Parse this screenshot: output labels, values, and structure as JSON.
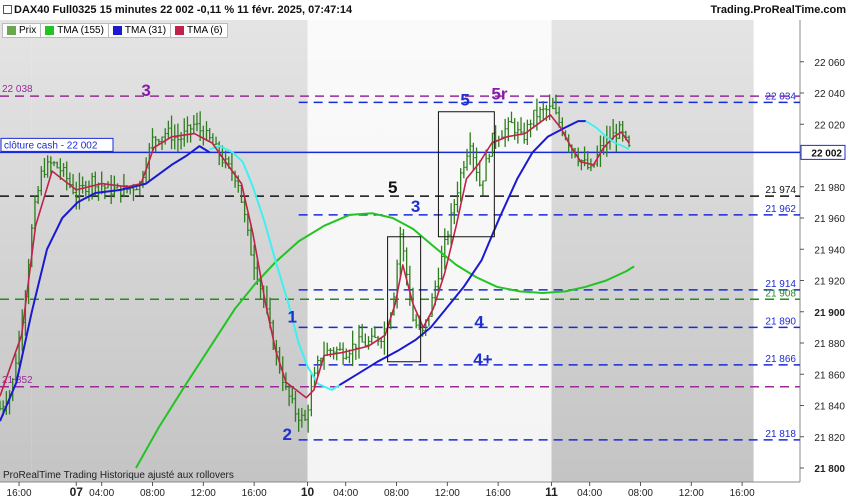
{
  "header": {
    "title": "DAX40 Full0325 15 minutes 22 002 -0,11 % 11 févr. 2025, 07:47:14",
    "brand": "Trading.ProRealTime.com"
  },
  "legend": [
    {
      "label": "Prix",
      "color": "#6aa84f"
    },
    {
      "label": "TMA (155)",
      "color": "#22c422"
    },
    {
      "label": "TMA (31)",
      "color": "#1a1acf"
    },
    {
      "label": "TMA (6)",
      "color": "#c0224a"
    }
  ],
  "footer": "ProRealTime Trading  Historique ajusté aux rollovers",
  "colors": {
    "bg_light": "#f4f4f4",
    "bg_dark": "#c4c4c4",
    "price": "#2e7d1e",
    "tma155": "#22c422",
    "tma31": "#1a1acf",
    "tma6": "#c0224a",
    "cyan": "#3ff0f0",
    "purple": "#9a2a9a",
    "blue_level": "#1a2ad8",
    "black_level": "#111111",
    "green_level": "#1f8f1f",
    "wave_blue": "#1f2fd0",
    "wave_purple": "#8a1aa8"
  },
  "chart_data": {
    "type": "line",
    "title": "DAX40 Full0325 15 minutes",
    "xlabel": "",
    "ylabel": "",
    "ylim": [
      21800,
      22060
    ],
    "y_ticks": [
      21800,
      21820,
      21840,
      21860,
      21880,
      21900,
      21920,
      21940,
      21960,
      21980,
      22000,
      22020,
      22040,
      22060
    ],
    "y_tick_labels": [
      "21 800",
      "21 820",
      "21 840",
      "21 860",
      "21 880",
      "21 900",
      "21 920",
      "21 940",
      "21 960",
      "21 980",
      "22 000",
      "22 020",
      "22 040",
      "22 060"
    ],
    "x_ticks": [
      {
        "label": "16:00",
        "t": 0.0
      },
      {
        "label": "07",
        "t": 4.5,
        "bold": true
      },
      {
        "label": "04:00",
        "t": 6.5
      },
      {
        "label": "08:00",
        "t": 10.5
      },
      {
        "label": "12:00",
        "t": 14.5
      },
      {
        "label": "16:00",
        "t": 18.5
      },
      {
        "label": "10",
        "t": 22.7,
        "bold": true
      },
      {
        "label": "04:00",
        "t": 25.7
      },
      {
        "label": "08:00",
        "t": 29.7
      },
      {
        "label": "12:00",
        "t": 33.7
      },
      {
        "label": "16:00",
        "t": 37.7
      },
      {
        "label": "11",
        "t": 41.9,
        "bold": true
      },
      {
        "label": "04:00",
        "t": 44.9
      },
      {
        "label": "08:00",
        "t": 48.9
      },
      {
        "label": "12:00",
        "t": 52.9
      },
      {
        "label": "16:00",
        "t": 56.9
      }
    ],
    "shading": [
      {
        "from": -1.5,
        "to": 0.95,
        "tone": "dark"
      },
      {
        "from": 0.95,
        "to": 22.7,
        "tone": "dark"
      },
      {
        "from": 22.7,
        "to": 41.9,
        "tone": "light"
      },
      {
        "from": 41.9,
        "to": 57.8,
        "tone": "dark"
      }
    ],
    "levels": [
      {
        "value": 22038,
        "color": "purple",
        "dash": "dash",
        "label": "22 038",
        "label_side": "left"
      },
      {
        "value": 22034,
        "color": "blue_level",
        "dash": "dash",
        "label": "22 034",
        "label_side": "right",
        "from_t": 22.0
      },
      {
        "value": 22002,
        "color": "blue_level",
        "dash": "solid",
        "label": "clôture cash -  22 002",
        "label_side": "left-box"
      },
      {
        "value": 21974,
        "color": "black_level",
        "dash": "dash",
        "label": "21 974",
        "label_side": "right"
      },
      {
        "value": 21962,
        "color": "blue_level",
        "dash": "dash",
        "label": "21 962",
        "label_side": "right",
        "from_t": 22.0
      },
      {
        "value": 21914,
        "color": "blue_level",
        "dash": "dash",
        "label": "21 914",
        "label_side": "right",
        "from_t": 22.0
      },
      {
        "value": 21908,
        "color": "green_level",
        "dash": "dash",
        "label": "21 908",
        "label_side": "right"
      },
      {
        "value": 21890,
        "color": "blue_level",
        "dash": "dash",
        "label": "21 890",
        "label_side": "right",
        "from_t": 22.0
      },
      {
        "value": 21866,
        "color": "blue_level",
        "dash": "dash",
        "label": "21 866",
        "label_side": "right",
        "from_t": 22.0
      },
      {
        "value": 21852,
        "color": "purple",
        "dash": "dash",
        "label": "21 852",
        "label_side": "left"
      },
      {
        "value": 21818,
        "color": "blue_level",
        "dash": "dash",
        "label": "21 818",
        "label_side": "right",
        "from_t": 22.0
      }
    ],
    "current_price": {
      "value": 22002,
      "label": "22 002"
    },
    "price_anchors": [
      [
        -1.5,
        21838
      ],
      [
        -0.6,
        21850
      ],
      [
        0.4,
        21905
      ],
      [
        1.1,
        21960
      ],
      [
        1.8,
        21990
      ],
      [
        2.6,
        21995
      ],
      [
        3.4,
        21990
      ],
      [
        4.5,
        21975
      ],
      [
        5.8,
        21985
      ],
      [
        7.0,
        21978
      ],
      [
        8.4,
        21978
      ],
      [
        9.5,
        21982
      ],
      [
        10.5,
        22010
      ],
      [
        11.6,
        22015
      ],
      [
        12.6,
        22010
      ],
      [
        13.8,
        22020
      ],
      [
        15.0,
        22010
      ],
      [
        16.2,
        21995
      ],
      [
        17.2,
        21985
      ],
      [
        18.2,
        21940
      ],
      [
        19.2,
        21910
      ],
      [
        20.0,
        21880
      ],
      [
        21.0,
        21850
      ],
      [
        21.8,
        21835
      ],
      [
        22.5,
        21830
      ],
      [
        23.0,
        21850
      ],
      [
        23.7,
        21872
      ],
      [
        24.6,
        21876
      ],
      [
        25.6,
        21874
      ],
      [
        26.6,
        21880
      ],
      [
        27.6,
        21880
      ],
      [
        28.6,
        21885
      ],
      [
        29.4,
        21905
      ],
      [
        30.0,
        21950
      ],
      [
        30.4,
        21930
      ],
      [
        31.0,
        21895
      ],
      [
        31.7,
        21885
      ],
      [
        32.3,
        21900
      ],
      [
        33.0,
        21925
      ],
      [
        34.0,
        21960
      ],
      [
        34.8,
        21990
      ],
      [
        35.5,
        22010
      ],
      [
        36.3,
        21980
      ],
      [
        37.2,
        22010
      ],
      [
        38.0,
        22015
      ],
      [
        38.8,
        22020
      ],
      [
        39.6,
        22010
      ],
      [
        40.4,
        22025
      ],
      [
        41.2,
        22028
      ],
      [
        41.9,
        22030
      ],
      [
        42.6,
        22020
      ],
      [
        43.3,
        22008
      ],
      [
        44.1,
        21998
      ],
      [
        45.0,
        21990
      ],
      [
        45.8,
        22005
      ],
      [
        46.6,
        22012
      ],
      [
        47.3,
        22016
      ],
      [
        48.0,
        22004
      ]
    ],
    "tma6": [
      [
        -1.5,
        21846
      ],
      [
        0.2,
        21885
      ],
      [
        1.3,
        21955
      ],
      [
        2.6,
        21990
      ],
      [
        4.5,
        21978
      ],
      [
        6.5,
        21982
      ],
      [
        8.5,
        21980
      ],
      [
        9.6,
        21982
      ],
      [
        10.6,
        22005
      ],
      [
        12.0,
        22012
      ],
      [
        13.8,
        22014
      ],
      [
        15.2,
        22008
      ],
      [
        16.6,
        21992
      ],
      [
        17.5,
        21982
      ],
      [
        18.4,
        21950
      ],
      [
        19.4,
        21905
      ],
      [
        20.2,
        21875
      ],
      [
        21.0,
        21855
      ],
      [
        21.8,
        21850
      ],
      [
        22.6,
        21845
      ],
      [
        23.2,
        21850
      ],
      [
        24.0,
        21872
      ],
      [
        25.5,
        21874
      ],
      [
        27.5,
        21878
      ],
      [
        28.8,
        21885
      ],
      [
        29.6,
        21905
      ],
      [
        30.2,
        21930
      ],
      [
        31.0,
        21905
      ],
      [
        31.8,
        21890
      ],
      [
        32.6,
        21902
      ],
      [
        33.5,
        21925
      ],
      [
        34.4,
        21955
      ],
      [
        35.2,
        21985
      ],
      [
        36.2,
        21995
      ],
      [
        37.2,
        22008
      ],
      [
        38.4,
        22012
      ],
      [
        39.8,
        22014
      ],
      [
        40.8,
        22020
      ],
      [
        41.8,
        22026
      ],
      [
        42.6,
        22018
      ],
      [
        43.4,
        22006
      ],
      [
        44.2,
        21996
      ],
      [
        45.2,
        21994
      ],
      [
        46.0,
        22005
      ],
      [
        46.8,
        22012
      ],
      [
        47.4,
        22015
      ],
      [
        48.0,
        22008
      ]
    ],
    "tma31": [
      [
        -1.5,
        21830
      ],
      [
        -0.2,
        21855
      ],
      [
        1.0,
        21900
      ],
      [
        2.2,
        21940
      ],
      [
        3.4,
        21960
      ],
      [
        4.6,
        21970
      ],
      [
        6.0,
        21976
      ],
      [
        8.0,
        21978
      ],
      [
        10.0,
        21982
      ],
      [
        12.0,
        21994
      ],
      [
        13.2,
        22000
      ],
      [
        14.2,
        22006
      ],
      [
        15.0,
        22002
      ]
    ],
    "tma31_late": [
      [
        25.2,
        21853
      ],
      [
        26.6,
        21860
      ],
      [
        28.2,
        21868
      ],
      [
        29.8,
        21875
      ],
      [
        31.2,
        21882
      ],
      [
        32.4,
        21890
      ],
      [
        33.6,
        21902
      ],
      [
        35.0,
        21916
      ],
      [
        36.4,
        21933
      ],
      [
        37.8,
        21960
      ],
      [
        39.2,
        21985
      ],
      [
        40.4,
        22002
      ],
      [
        41.6,
        22012
      ],
      [
        43.0,
        22018
      ],
      [
        44.0,
        22022
      ],
      [
        44.6,
        22022
      ]
    ],
    "cyan_tma31": [
      [
        15.0,
        22004
      ],
      [
        15.8,
        22006
      ],
      [
        16.8,
        22002
      ],
      [
        17.6,
        21996
      ],
      [
        18.4,
        21980
      ],
      [
        19.3,
        21958
      ],
      [
        20.2,
        21932
      ],
      [
        21.2,
        21905
      ],
      [
        22.0,
        21880
      ],
      [
        22.7,
        21865
      ],
      [
        23.5,
        21854
      ],
      [
        24.6,
        21850
      ],
      [
        25.2,
        21853
      ]
    ],
    "cyan_tma6_tail": [
      [
        44.6,
        22022
      ],
      [
        45.4,
        22018
      ],
      [
        46.2,
        22012
      ],
      [
        46.9,
        22008
      ],
      [
        47.5,
        22006
      ],
      [
        48.0,
        22004
      ]
    ],
    "tma155": [
      [
        9.2,
        21800
      ],
      [
        11.0,
        21826
      ],
      [
        13.0,
        21852
      ],
      [
        15.0,
        21877
      ],
      [
        17.0,
        21902
      ],
      [
        18.6,
        21918
      ],
      [
        20.2,
        21932
      ],
      [
        22.0,
        21945
      ],
      [
        24.0,
        21955
      ],
      [
        26.0,
        21962
      ],
      [
        27.8,
        21963
      ],
      [
        29.4,
        21960
      ],
      [
        31.0,
        21953
      ],
      [
        32.6,
        21942
      ],
      [
        34.4,
        21930
      ],
      [
        36.0,
        21922
      ],
      [
        37.6,
        21916
      ],
      [
        39.4,
        21913
      ],
      [
        41.2,
        21912
      ],
      [
        43.0,
        21913
      ],
      [
        44.6,
        21916
      ],
      [
        46.2,
        21920
      ],
      [
        47.8,
        21926
      ],
      [
        48.4,
        21929
      ]
    ],
    "boxes": [
      {
        "t1": 29.0,
        "t2": 31.6,
        "y1": 21868,
        "y2": 21948
      },
      {
        "t1": 33.0,
        "t2": 37.4,
        "y1": 21948,
        "y2": 22028
      }
    ],
    "annotations": [
      {
        "text": "3",
        "t": 10.0,
        "v": 22038,
        "color": "wave_purple",
        "size": 17
      },
      {
        "text": "1",
        "t": 21.5,
        "v": 21893,
        "color": "wave_blue",
        "size": 17
      },
      {
        "text": "2",
        "t": 21.1,
        "v": 21818,
        "color": "wave_blue",
        "size": 17
      },
      {
        "text": "5",
        "t": 29.4,
        "v": 21976,
        "color": "black_level",
        "size": 17
      },
      {
        "text": "3",
        "t": 31.2,
        "v": 21964,
        "color": "wave_blue",
        "size": 17
      },
      {
        "text": "5",
        "t": 35.1,
        "v": 22032,
        "color": "wave_blue",
        "size": 17
      },
      {
        "text": "5r",
        "t": 37.8,
        "v": 22036,
        "color": "wave_purple",
        "size": 17
      },
      {
        "text": "4",
        "t": 36.2,
        "v": 21890,
        "color": "wave_blue",
        "size": 17
      },
      {
        "text": "4+",
        "t": 36.5,
        "v": 21866,
        "color": "wave_blue",
        "size": 17
      }
    ]
  }
}
